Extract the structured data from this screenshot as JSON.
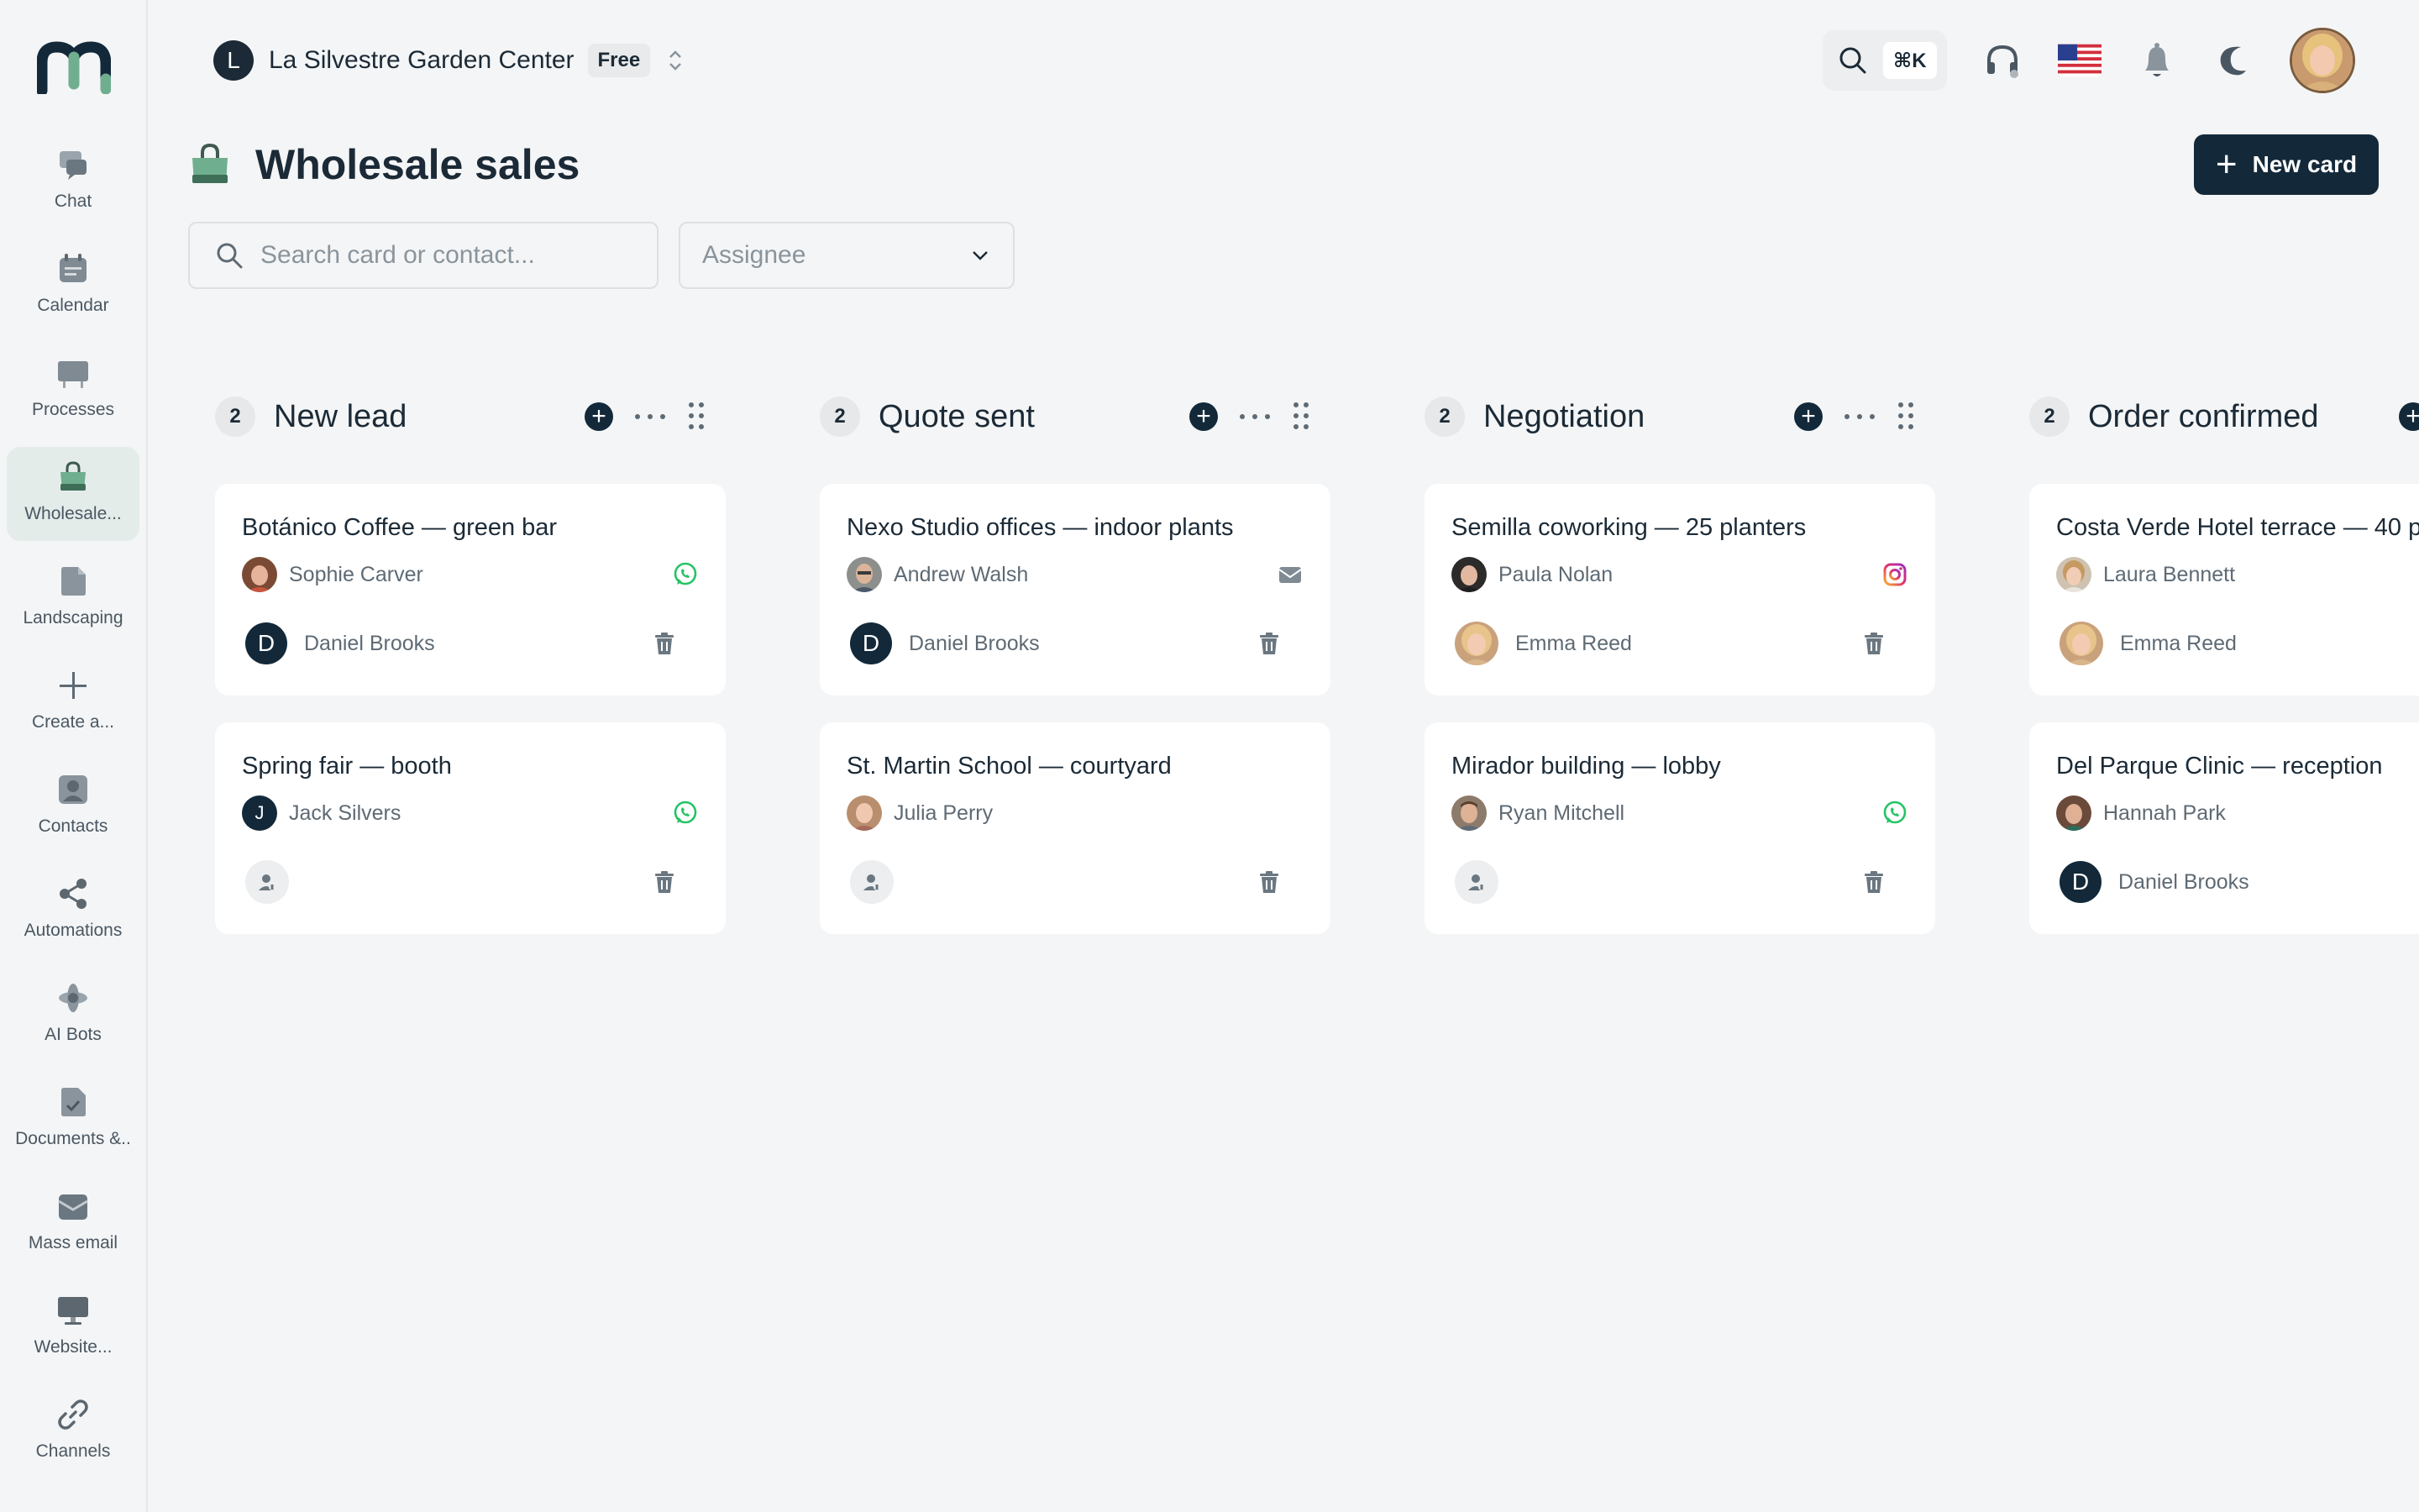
{
  "sidebar": {
    "items": [
      {
        "label": "Chat",
        "icon": "chat-icon"
      },
      {
        "label": "Calendar",
        "icon": "calendar-icon"
      },
      {
        "label": "Processes",
        "icon": "processes-icon"
      },
      {
        "label": "Wholesale...",
        "icon": "shopping-bag-icon",
        "active": true
      },
      {
        "label": "Landscaping",
        "icon": "file-icon"
      },
      {
        "label": "Create a...",
        "icon": "plus-icon"
      },
      {
        "label": "Contacts",
        "icon": "contacts-icon"
      },
      {
        "label": "Automations",
        "icon": "share-icon"
      },
      {
        "label": "AI Bots",
        "icon": "ai-bot-icon"
      },
      {
        "label": "Documents &..",
        "icon": "document-icon"
      },
      {
        "label": "Mass email",
        "icon": "mail-icon"
      },
      {
        "label": "Website...",
        "icon": "monitor-icon"
      },
      {
        "label": "Channels",
        "icon": "link-icon"
      }
    ]
  },
  "header": {
    "org_initial": "L",
    "org_name": "La Silvestre Garden Center",
    "plan": "Free",
    "shortcut": "⌘K"
  },
  "page": {
    "title": "Wholesale sales",
    "new_card_label": "New card",
    "search_placeholder": "Search card or contact...",
    "assignee_placeholder": "Assignee"
  },
  "colors": {
    "accent": "#13293a",
    "active_nav": "#e4ecea",
    "whatsapp": "#25c365",
    "bag": "#5e9a7e"
  },
  "columns": [
    {
      "count": "2",
      "title": "New lead",
      "cards": [
        {
          "title": "Botánico Coffee — green bar",
          "contact": "Sophie Carver",
          "contact_avatar": "photo",
          "channel": "whatsapp-icon",
          "owner_initial": "D",
          "owner": "Daniel Brooks"
        },
        {
          "title": "Spring fair — booth",
          "contact": "Jack Silvers",
          "contact_avatar": "initial",
          "contact_initial": "J",
          "channel": "whatsapp-icon",
          "owner": ""
        }
      ]
    },
    {
      "count": "2",
      "title": "Quote sent",
      "cards": [
        {
          "title": "Nexo Studio offices — indoor plants",
          "contact": "Andrew Walsh",
          "contact_avatar": "photo",
          "channel": "email-icon",
          "owner_initial": "D",
          "owner": "Daniel Brooks"
        },
        {
          "title": "St. Martin School — courtyard",
          "contact": "Julia Perry",
          "contact_avatar": "photo",
          "channel": "",
          "owner": ""
        }
      ]
    },
    {
      "count": "2",
      "title": "Negotiation",
      "cards": [
        {
          "title": "Semilla coworking — 25 planters",
          "contact": "Paula Nolan",
          "contact_avatar": "photo",
          "channel": "instagram-icon",
          "owner_photo": true,
          "owner": "Emma Reed"
        },
        {
          "title": "Mirador building — lobby",
          "contact": "Ryan Mitchell",
          "contact_avatar": "photo",
          "channel": "whatsapp-icon",
          "owner": ""
        }
      ]
    },
    {
      "count": "2",
      "title": "Order confirmed",
      "cards": [
        {
          "title": "Costa Verde Hotel terrace — 40 p",
          "contact": "Laura Bennett",
          "contact_avatar": "photo",
          "channel": "",
          "owner_photo": true,
          "owner": "Emma Reed"
        },
        {
          "title": "Del Parque Clinic — reception",
          "contact": "Hannah Park",
          "contact_avatar": "photo",
          "channel": "",
          "owner_initial": "D",
          "owner": "Daniel Brooks"
        }
      ]
    }
  ]
}
